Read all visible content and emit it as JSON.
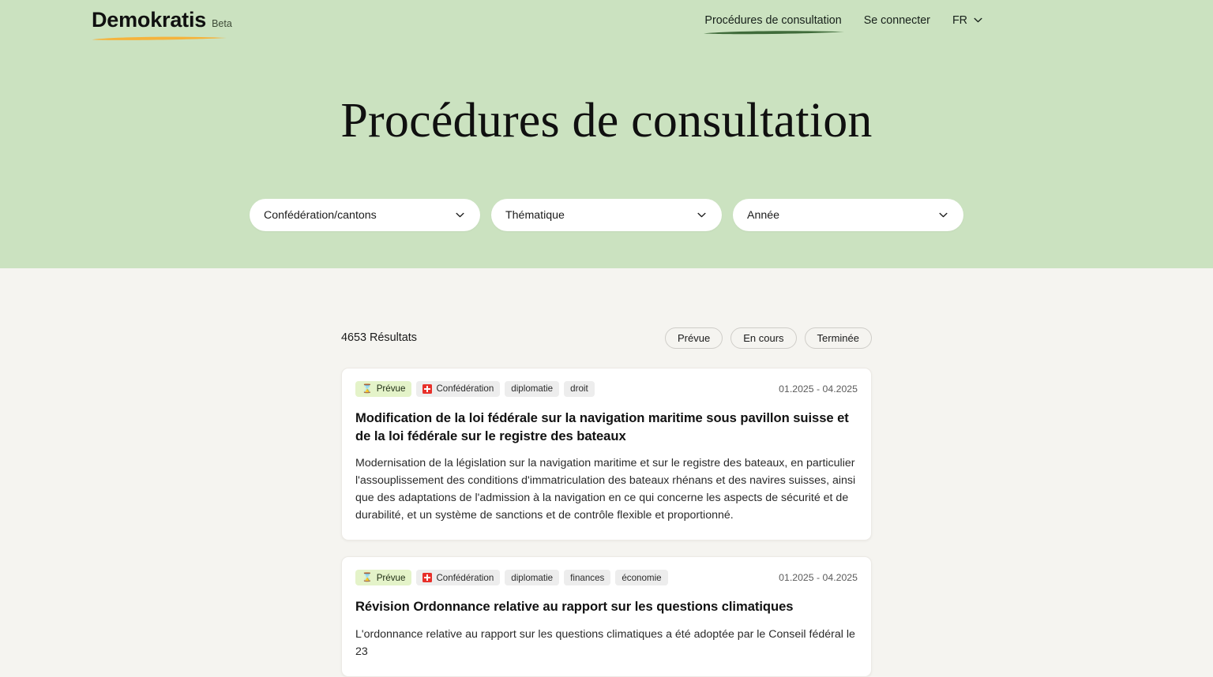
{
  "brand": {
    "name": "Demokratis",
    "badge": "Beta"
  },
  "nav": {
    "items": [
      {
        "label": "Procédures de consultation",
        "active": true
      },
      {
        "label": "Se connecter",
        "active": false
      }
    ],
    "language": "FR",
    "chevron_icon": "chevron-down-icon"
  },
  "hero": {
    "title": "Procédures de consultation",
    "background_color": "#cbe2c0",
    "accent_color": "#f5b33c"
  },
  "filters": [
    {
      "name": "confederation-cantons",
      "label": "Confédération/cantons"
    },
    {
      "name": "thematique",
      "label": "Thématique"
    },
    {
      "name": "annee",
      "label": "Année"
    }
  ],
  "results": {
    "count_label": "4653 Résultats",
    "status_filters": [
      "Prévue",
      "En cours",
      "Terminée"
    ]
  },
  "cards": [
    {
      "status": {
        "label": "Prévue",
        "icon": "hourglass-icon"
      },
      "authority": {
        "label": "Confédération",
        "icon": "swiss-flag-icon"
      },
      "topics": [
        "diplomatie",
        "droit"
      ],
      "date": "01.2025 - 04.2025",
      "title": "Modification de la loi fédérale sur la navigation maritime sous pavillon suisse et de la loi fédérale sur le registre des bateaux",
      "description": "Modernisation de la législation sur la navigation maritime et sur le registre des bateaux, en particulier l'assouplissement des conditions d'immatriculation des bateaux rhénans et des navires suisses, ainsi que des adaptations de l'admission à la navigation en ce qui concerne les aspects de sécurité et de durabilité, et un système de sanctions et de contrôle flexible et proportionné."
    },
    {
      "status": {
        "label": "Prévue",
        "icon": "hourglass-icon"
      },
      "authority": {
        "label": "Confédération",
        "icon": "swiss-flag-icon"
      },
      "topics": [
        "diplomatie",
        "finances",
        "économie"
      ],
      "date": "01.2025 - 04.2025",
      "title": "Révision Ordonnance relative au rapport sur les questions climatiques",
      "description": "L'ordonnance relative au rapport sur les questions climatiques a été adoptée par le Conseil fédéral le 23"
    }
  ]
}
